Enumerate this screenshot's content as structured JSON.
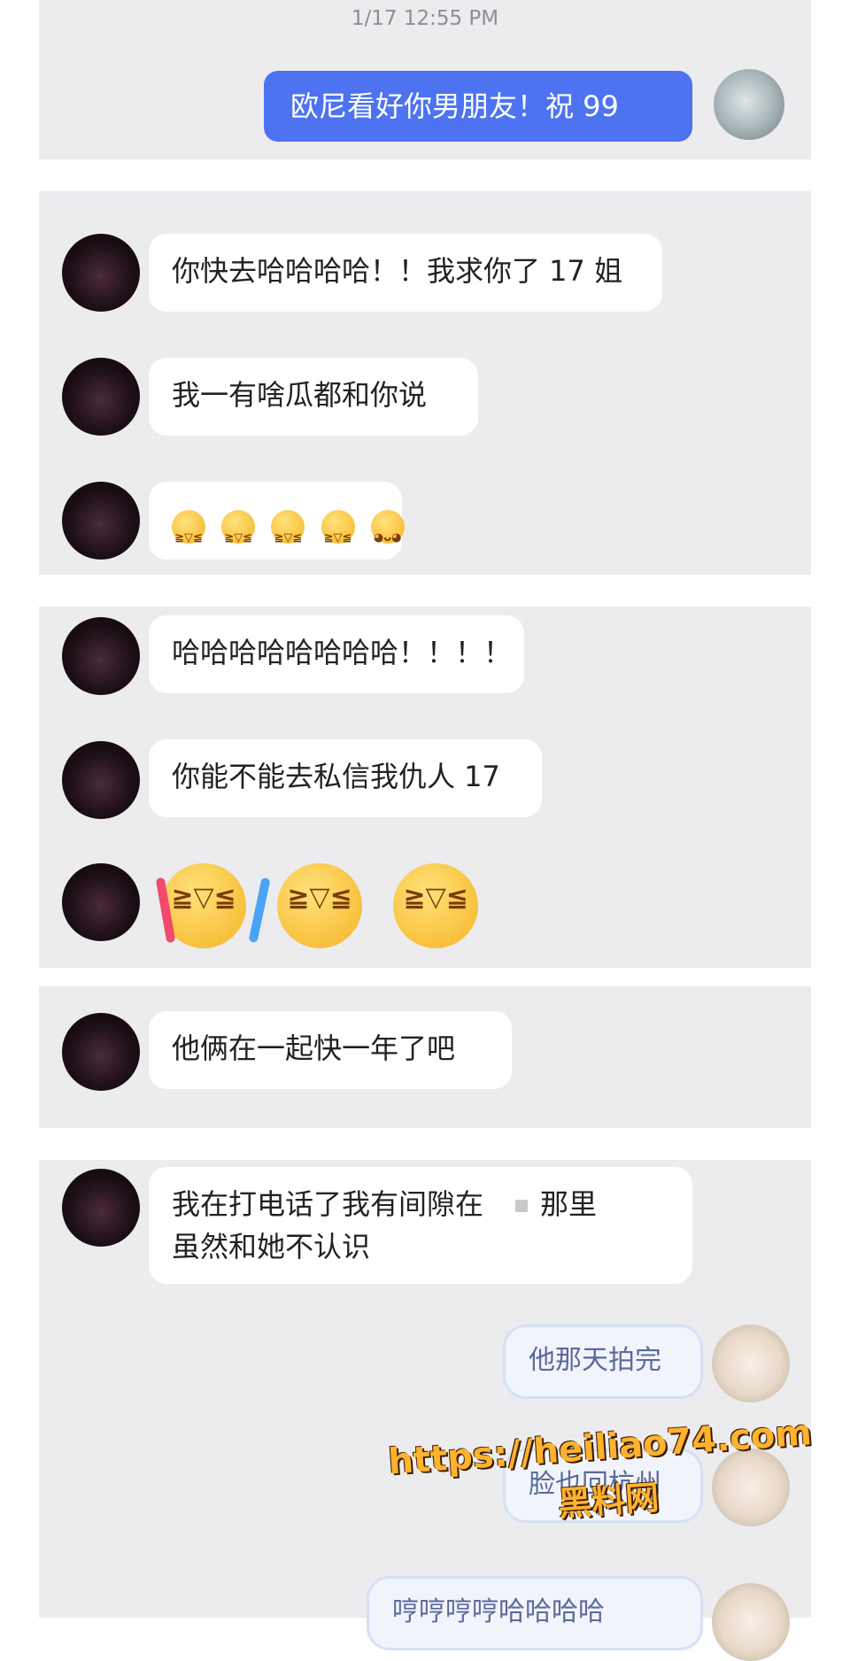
{
  "timestamp": "1/17 12:55 PM",
  "messages": {
    "m1": "欧尼看好你男朋友！祝 99",
    "m2": "你快去哈哈哈哈！！我求你了 17 姐",
    "m3": "我一有啥瓜都和你说",
    "m5": "哈哈哈哈哈哈哈哈！！！！",
    "m6": "你能不能去私信我仇人 17",
    "m8": "他俩在一起快一年了吧",
    "m9_line1": "我在打电话了我有间隙在",
    "m9_line1b": "那里",
    "m9_line2": "虽然和她不认识",
    "m10": "他那天拍完",
    "m11": "脸也回杭州",
    "m12": "哼哼哼哼哈哈哈哈"
  },
  "emoji": {
    "laugh_face": "≧▽≦",
    "tongue_face": "◕ᴗ◕"
  },
  "watermark": {
    "url": "https://heiliao74.com",
    "name": "黑料网"
  },
  "colors": {
    "panel_bg": "#ececef",
    "blue_bubble": "#4d73f1",
    "watermark": "#ffb22e"
  }
}
